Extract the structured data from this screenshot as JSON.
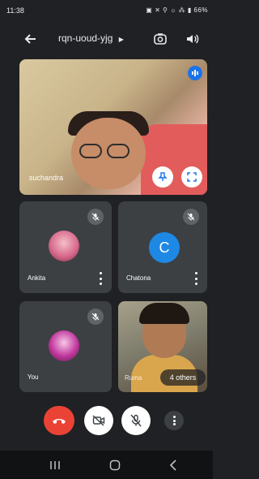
{
  "status_bar": {
    "time": "11:38",
    "status_icons": "▣ ✕ ⚲ ☼ ⁂ ▮ 66%"
  },
  "top_bar": {
    "meeting_code": "rqn-uoud-yjg"
  },
  "main_tile": {
    "participant_name": "suchandra"
  },
  "tiles": [
    {
      "name": "Ankita",
      "avatar": "photo"
    },
    {
      "name": "Chatona",
      "avatar_letter": "C"
    },
    {
      "name": "You",
      "avatar": "photo"
    },
    {
      "name": "Ruma",
      "others_label": "4 others"
    }
  ],
  "icons": {
    "back": "arrow-back-icon",
    "switch_camera": "switch-camera-icon",
    "speaker": "speaker-icon",
    "pin": "pin-icon",
    "fullscreen": "fullscreen-icon",
    "mic_off": "mic-off-icon",
    "end_call": "end-call-icon",
    "camera_off": "camera-off-icon",
    "more": "more-vert-icon"
  },
  "colors": {
    "background": "#202124",
    "tile": "#3c4043",
    "end_call": "#ea4335",
    "accent": "#1a73e8",
    "avatar_c": "#1e88e5"
  }
}
